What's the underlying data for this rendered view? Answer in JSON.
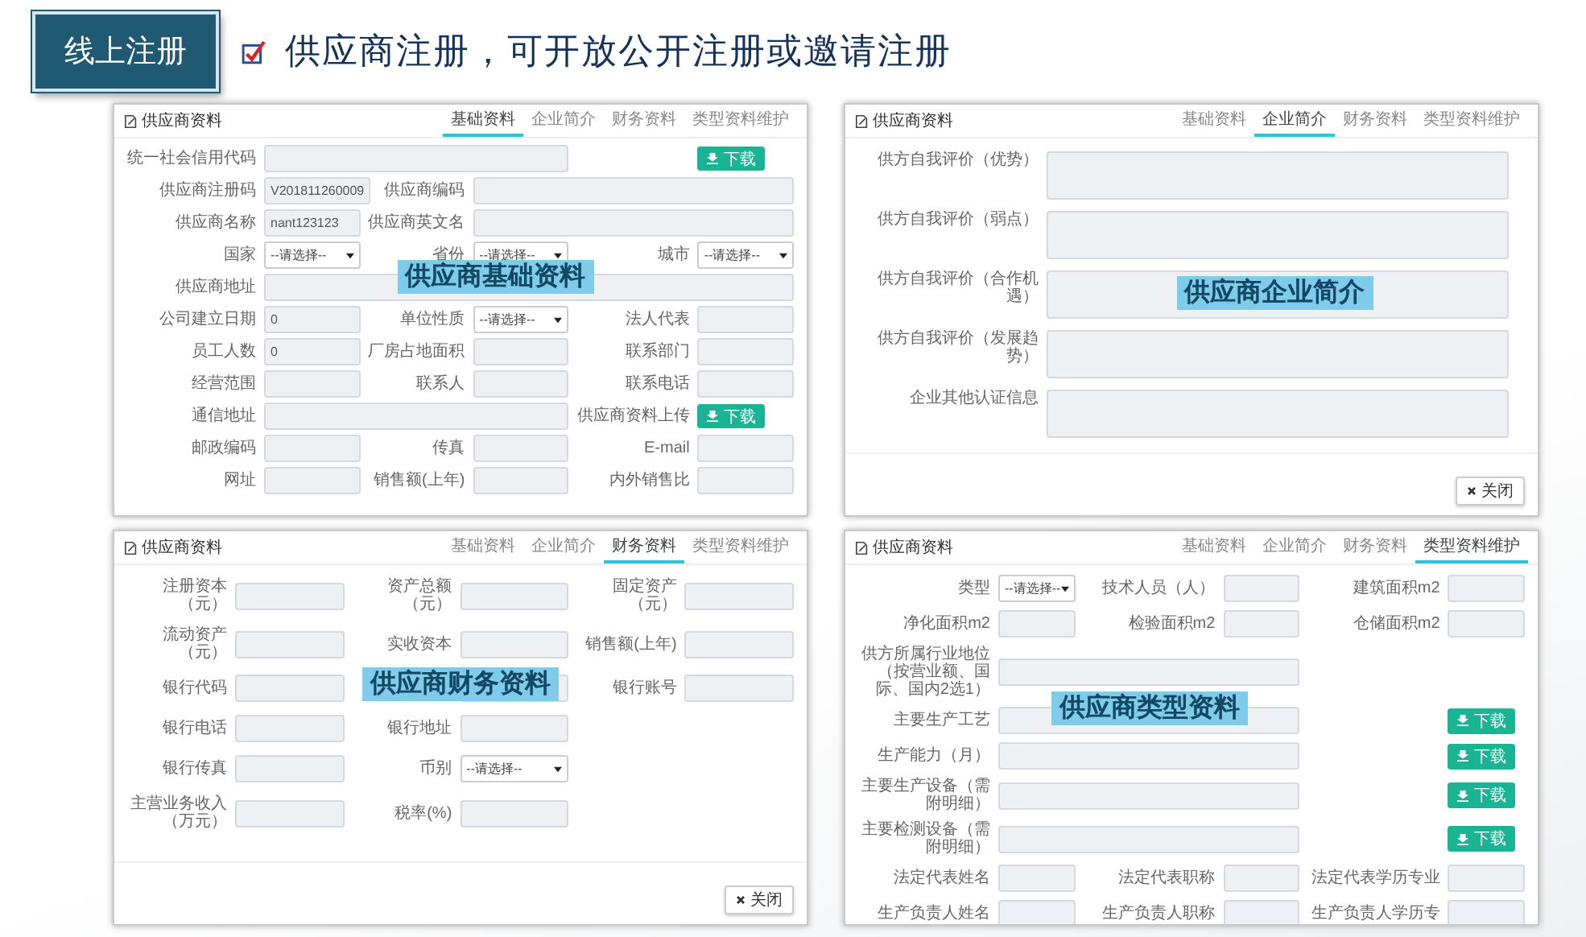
{
  "header": {
    "badge": "线上注册",
    "checked": true,
    "title": "供应商注册，可开放公开注册或邀请注册"
  },
  "panels": [
    {
      "title": "供应商资料",
      "overlay": "供应商基础资料",
      "tabs": [
        {
          "label": "基础资料",
          "selected": true
        },
        {
          "label": "企业简介",
          "selected": false
        },
        {
          "label": "财务资料",
          "selected": false
        },
        {
          "label": "类型资料维护",
          "selected": false
        }
      ],
      "rows": [
        [
          {
            "label": "统一社会信用代码",
            "kind": "input_wide"
          },
          {
            "kind": "button",
            "text": "下载"
          }
        ],
        [
          {
            "label": "供应商注册码",
            "kind": "input",
            "value": "V201811260009"
          },
          {
            "label": "供应商编码",
            "kind": "input_wide"
          }
        ],
        [
          {
            "label": "供应商名称",
            "kind": "input",
            "value": "nant123123"
          },
          {
            "label": "供应商英文名",
            "kind": "input_wide"
          }
        ],
        [
          {
            "label": "国家",
            "kind": "select",
            "value": "--请选择--"
          },
          {
            "label": "省份",
            "kind": "select",
            "value": "--请选择--"
          },
          {
            "label": "城市",
            "kind": "select",
            "value": "--请选择--"
          }
        ],
        [
          {
            "label": "供应商地址",
            "kind": "input_full"
          }
        ],
        [
          {
            "label": "公司建立日期",
            "kind": "input",
            "value": "0"
          },
          {
            "label": "单位性质",
            "kind": "select",
            "value": "--请选择--"
          },
          {
            "label": "法人代表",
            "kind": "input"
          }
        ],
        [
          {
            "label": "员工人数",
            "kind": "input",
            "value": "0"
          },
          {
            "label": "厂房占地面积",
            "kind": "input"
          },
          {
            "label": "联系部门",
            "kind": "input"
          }
        ],
        [
          {
            "label": "经营范围",
            "kind": "input"
          },
          {
            "label": "联系人",
            "kind": "input"
          },
          {
            "label": "联系电话",
            "kind": "input"
          }
        ],
        [
          {
            "label": "通信地址",
            "kind": "input_wide"
          },
          {
            "label": "供应商资料上传",
            "kind": "button",
            "text": "下载"
          }
        ],
        [
          {
            "label": "邮政编码",
            "kind": "input"
          },
          {
            "label": "传真",
            "kind": "input"
          },
          {
            "label": "E-mail",
            "kind": "input"
          }
        ],
        [
          {
            "label": "网址",
            "kind": "input"
          },
          {
            "label": "销售额(上年)",
            "kind": "input"
          },
          {
            "label": "内外销售比",
            "kind": "input"
          }
        ]
      ]
    },
    {
      "title": "供应商资料",
      "overlay": "供应商企业简介",
      "close_button": "关闭",
      "tabs": [
        {
          "label": "基础资料",
          "selected": false
        },
        {
          "label": "企业简介",
          "selected": true
        },
        {
          "label": "财务资料",
          "selected": false
        },
        {
          "label": "类型资料维护",
          "selected": false
        }
      ],
      "rows": [
        [
          {
            "label": "供方自我评价（优势）",
            "kind": "textarea"
          }
        ],
        [
          {
            "label": "供方自我评价（弱点）",
            "kind": "textarea"
          }
        ],
        [
          {
            "label": "供方自我评价（合作机遇）",
            "kind": "textarea"
          }
        ],
        [
          {
            "label": "供方自我评价（发展趋势）",
            "kind": "textarea"
          }
        ],
        [
          {
            "label": "企业其他认证信息",
            "kind": "textarea"
          }
        ]
      ]
    },
    {
      "title": "供应商资料",
      "overlay": "供应商财务资料",
      "close_button": "关闭",
      "tabs": [
        {
          "label": "基础资料",
          "selected": false
        },
        {
          "label": "企业简介",
          "selected": false
        },
        {
          "label": "财务资料",
          "selected": true
        },
        {
          "label": "类型资料维护",
          "selected": false
        }
      ],
      "rows": [
        [
          {
            "label": "注册资本（元）",
            "kind": "input"
          },
          {
            "label": "资产总额（元）",
            "kind": "input"
          },
          {
            "label": "固定资产（元）",
            "kind": "input"
          }
        ],
        [
          {
            "label": "流动资产（元）",
            "kind": "input"
          },
          {
            "label": "实收资本",
            "kind": "input"
          },
          {
            "label": "销售额(上年)",
            "kind": "input"
          }
        ],
        [
          {
            "label": "银行代码",
            "kind": "input"
          },
          {
            "kind": "input"
          },
          {
            "label": "银行账号",
            "kind": "input"
          }
        ],
        [
          {
            "label": "银行电话",
            "kind": "input"
          },
          {
            "label": "银行地址",
            "kind": "input"
          }
        ],
        [
          {
            "label": "银行传真",
            "kind": "input"
          },
          {
            "label": "币别",
            "kind": "select",
            "value": "--请选择--"
          }
        ],
        [
          {
            "label": "主营业务收入（万元）",
            "kind": "input"
          },
          {
            "label": "税率(%)",
            "kind": "input"
          }
        ]
      ]
    },
    {
      "title": "供应商资料",
      "overlay": "供应商类型资料",
      "tabs": [
        {
          "label": "基础资料",
          "selected": false
        },
        {
          "label": "企业简介",
          "selected": false
        },
        {
          "label": "财务资料",
          "selected": false
        },
        {
          "label": "类型资料维护",
          "selected": true
        }
      ],
      "rows": [
        [
          {
            "label": "类型",
            "kind": "select",
            "value": "--请选择--"
          },
          {
            "label": "技术人员（人）",
            "kind": "input"
          },
          {
            "label": "建筑面积m2",
            "kind": "input"
          }
        ],
        [
          {
            "label": "净化面积m2",
            "kind": "input"
          },
          {
            "label": "检验面积m2",
            "kind": "input"
          },
          {
            "label": "仓储面积m2",
            "kind": "input"
          }
        ],
        [
          {
            "label": "供方所属行业地位（按营业额、国际、国内2选1）",
            "kind": "input_wide"
          }
        ],
        [
          {
            "label": "主要生产工艺",
            "kind": "input_wide"
          },
          {
            "kind": "button",
            "text": "下载"
          }
        ],
        [
          {
            "label": "生产能力（月）",
            "kind": "input_wide"
          },
          {
            "kind": "button",
            "text": "下载"
          }
        ],
        [
          {
            "label": "主要生产设备（需附明细）",
            "kind": "input_wide"
          },
          {
            "kind": "button",
            "text": "下载"
          }
        ],
        [
          {
            "label": "主要检测设备（需附明细）",
            "kind": "input_wide"
          },
          {
            "kind": "button",
            "text": "下载"
          }
        ],
        [
          {
            "label": "法定代表姓名",
            "kind": "input"
          },
          {
            "label": "法定代表职称",
            "kind": "input"
          },
          {
            "label": "法定代表学历专业",
            "kind": "input"
          }
        ],
        [
          {
            "label": "生产负责人姓名",
            "kind": "input"
          },
          {
            "label": "生产负责人职称",
            "kind": "input"
          },
          {
            "label": "生产负责人学历专",
            "kind": "input"
          }
        ]
      ]
    }
  ]
}
